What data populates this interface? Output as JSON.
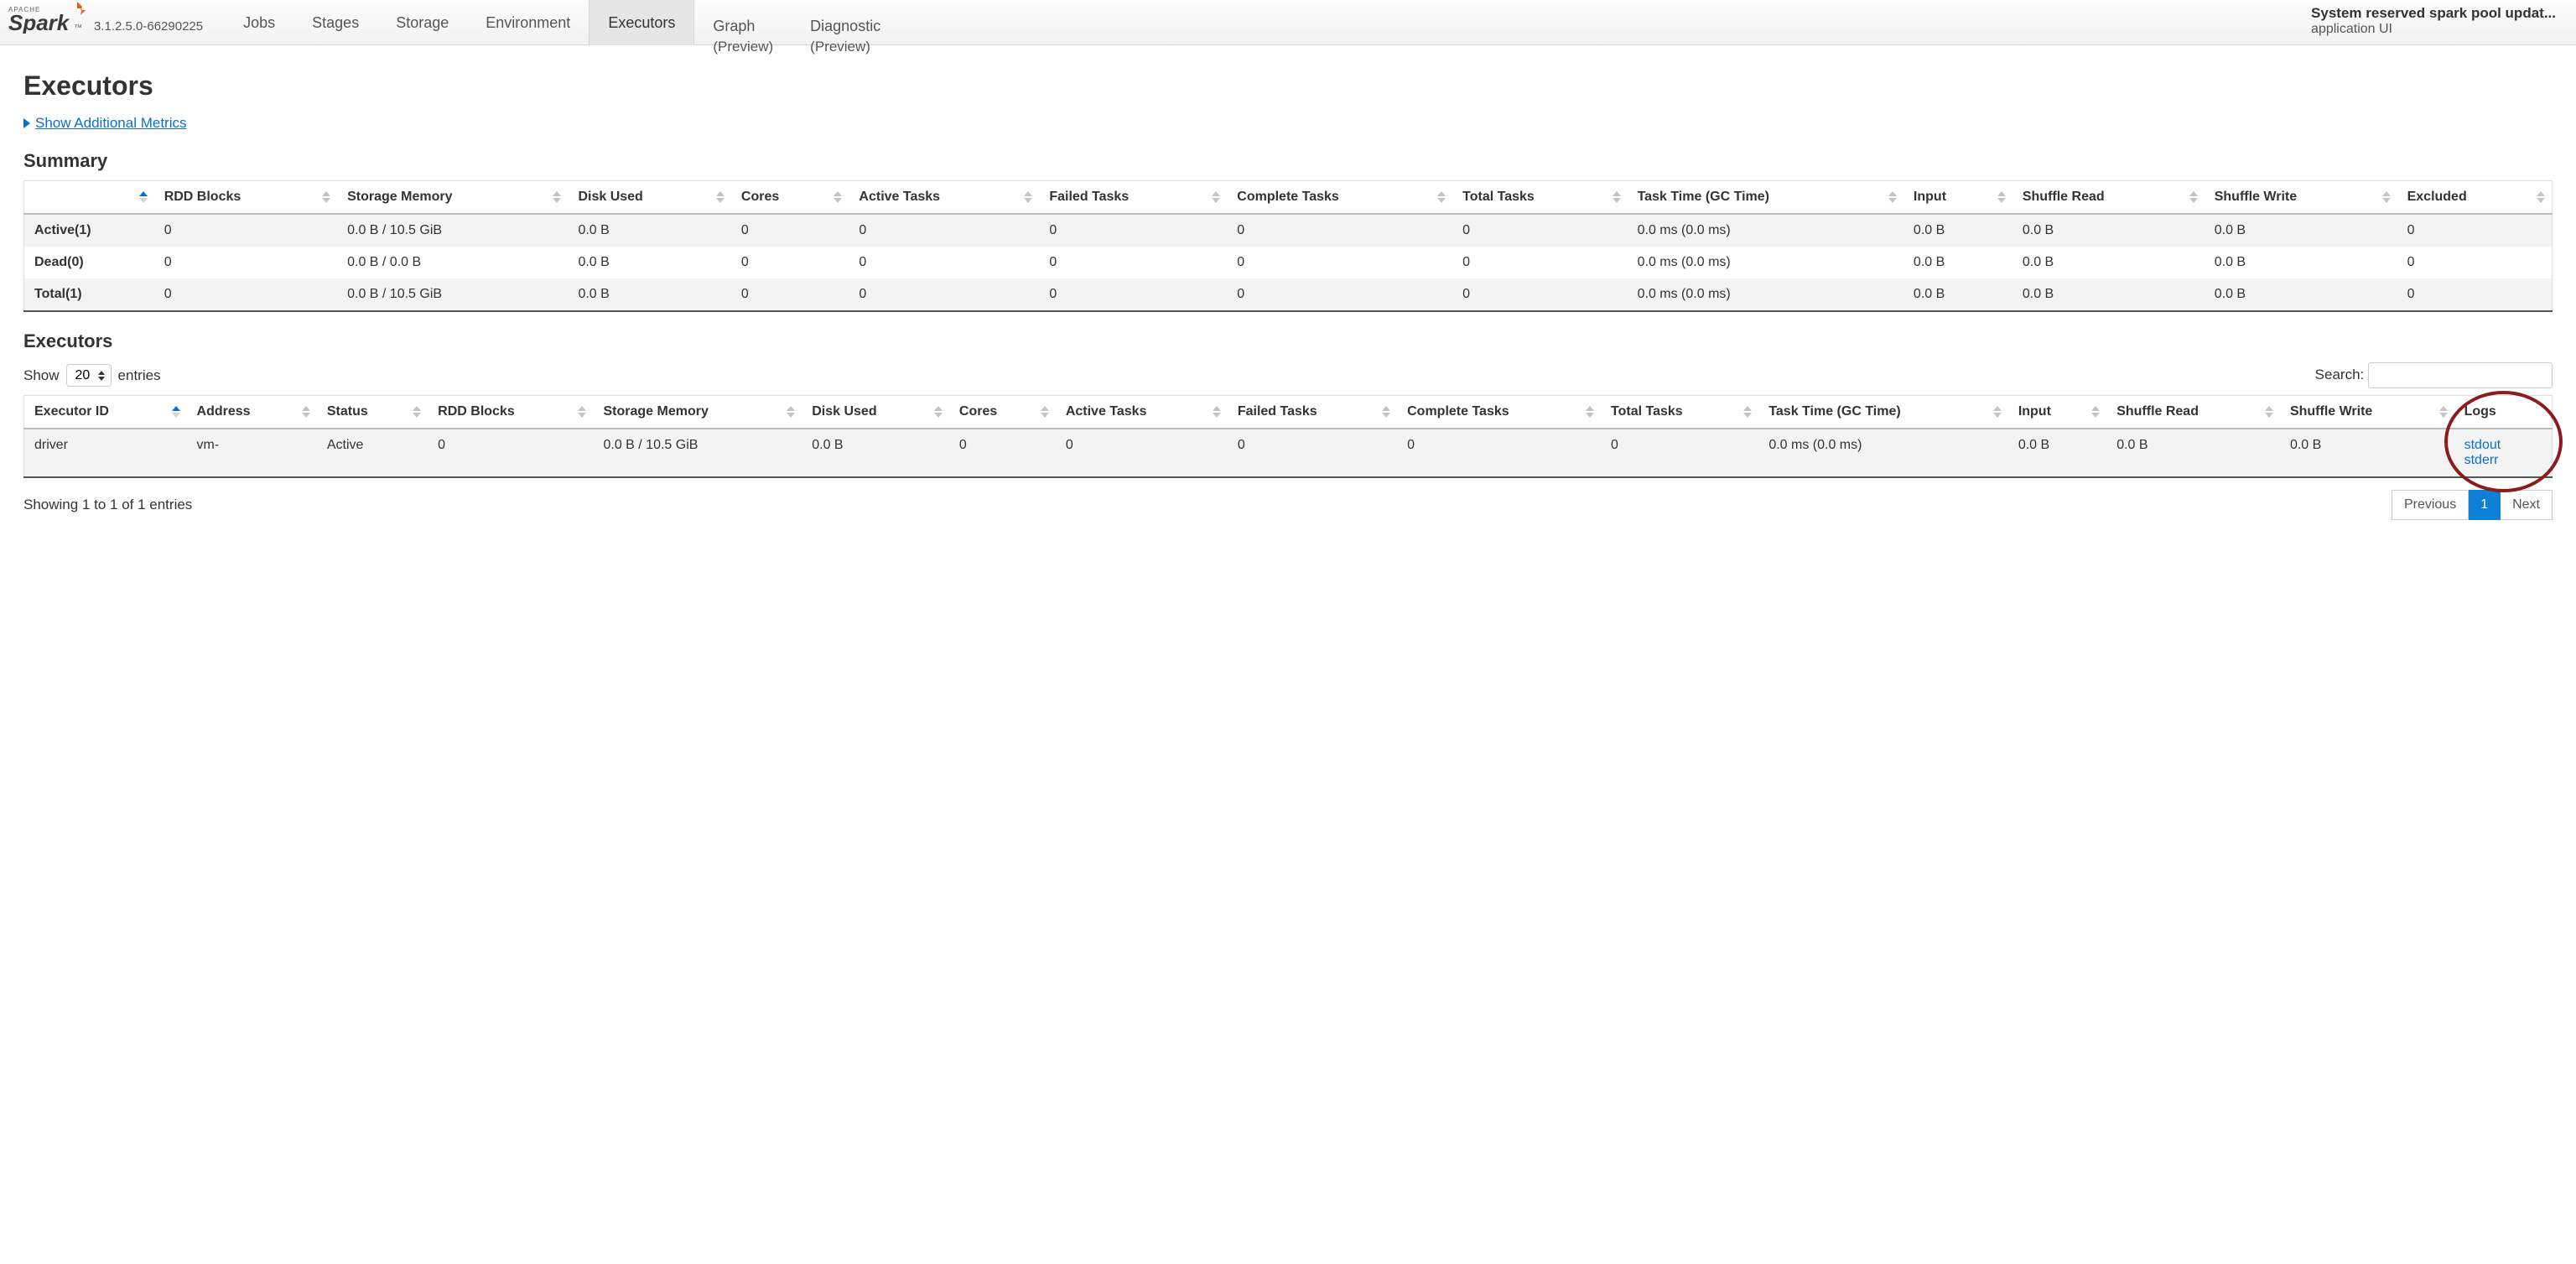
{
  "brand": {
    "version": "3.1.2.5.0-66290225"
  },
  "nav": {
    "jobs": "Jobs",
    "stages": "Stages",
    "storage": "Storage",
    "environment": "Environment",
    "executors": "Executors",
    "graph": "Graph",
    "graph_preview": "(Preview)",
    "diagnostic": "Diagnostic",
    "diagnostic_preview": "(Preview)"
  },
  "app": {
    "title": "System reserved spark pool updat...",
    "subtitle": "application UI"
  },
  "page": {
    "title": "Executors",
    "toggle_metrics": "Show Additional Metrics",
    "summary_heading": "Summary",
    "executors_heading": "Executors"
  },
  "summary": {
    "headers": [
      "",
      "RDD Blocks",
      "Storage Memory",
      "Disk Used",
      "Cores",
      "Active Tasks",
      "Failed Tasks",
      "Complete Tasks",
      "Total Tasks",
      "Task Time (GC Time)",
      "Input",
      "Shuffle Read",
      "Shuffle Write",
      "Excluded"
    ],
    "rows": [
      {
        "label": "Active(1)",
        "cells": [
          "0",
          "0.0 B / 10.5 GiB",
          "0.0 B",
          "0",
          "0",
          "0",
          "0",
          "0",
          "0.0 ms (0.0 ms)",
          "0.0 B",
          "0.0 B",
          "0.0 B",
          "0"
        ]
      },
      {
        "label": "Dead(0)",
        "cells": [
          "0",
          "0.0 B / 0.0 B",
          "0.0 B",
          "0",
          "0",
          "0",
          "0",
          "0",
          "0.0 ms (0.0 ms)",
          "0.0 B",
          "0.0 B",
          "0.0 B",
          "0"
        ]
      },
      {
        "label": "Total(1)",
        "cells": [
          "0",
          "0.0 B / 10.5 GiB",
          "0.0 B",
          "0",
          "0",
          "0",
          "0",
          "0",
          "0.0 ms (0.0 ms)",
          "0.0 B",
          "0.0 B",
          "0.0 B",
          "0"
        ]
      }
    ]
  },
  "datatable": {
    "show_label_pre": "Show",
    "show_value": "20",
    "show_label_post": "entries",
    "search_label": "Search:",
    "info": "Showing 1 to 1 of 1 entries",
    "prev": "Previous",
    "page": "1",
    "next": "Next"
  },
  "executors": {
    "headers": [
      "Executor ID",
      "Address",
      "Status",
      "RDD Blocks",
      "Storage Memory",
      "Disk Used",
      "Cores",
      "Active Tasks",
      "Failed Tasks",
      "Complete Tasks",
      "Total Tasks",
      "Task Time (GC Time)",
      "Input",
      "Shuffle Read",
      "Shuffle Write",
      "Logs"
    ],
    "rows": [
      {
        "cells": [
          "driver",
          "vm-",
          "Active",
          "0",
          "0.0 B / 10.5 GiB",
          "0.0 B",
          "0",
          "0",
          "0",
          "0",
          "0",
          "0.0 ms (0.0 ms)",
          "0.0 B",
          "0.0 B",
          "0.0 B"
        ],
        "logs": {
          "stdout": "stdout",
          "stderr": "stderr"
        }
      }
    ]
  }
}
